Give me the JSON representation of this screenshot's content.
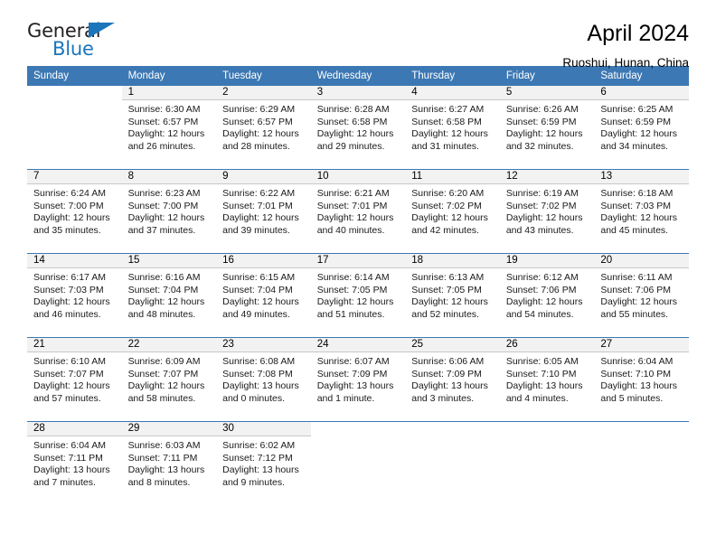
{
  "brand": {
    "name_top": "General",
    "name_bottom": "Blue",
    "triangle_color": "#1b75bb",
    "text_color": "#231f20"
  },
  "header": {
    "title": "April 2024",
    "subtitle": "Ruoshui, Hunan, China"
  },
  "theme": {
    "header_row_bg": "#3c78b4",
    "header_row_text": "#ffffff",
    "daynum_band_bg": "#f2f2f2",
    "cell_divider": "#c8c8c8"
  },
  "weekdays": [
    "Sunday",
    "Monday",
    "Tuesday",
    "Wednesday",
    "Thursday",
    "Friday",
    "Saturday"
  ],
  "weeks": [
    [
      {
        "day": "",
        "sunrise": "",
        "sunset": "",
        "daylight1": "",
        "daylight2": ""
      },
      {
        "day": "1",
        "sunrise": "Sunrise: 6:30 AM",
        "sunset": "Sunset: 6:57 PM",
        "daylight1": "Daylight: 12 hours",
        "daylight2": "and 26 minutes."
      },
      {
        "day": "2",
        "sunrise": "Sunrise: 6:29 AM",
        "sunset": "Sunset: 6:57 PM",
        "daylight1": "Daylight: 12 hours",
        "daylight2": "and 28 minutes."
      },
      {
        "day": "3",
        "sunrise": "Sunrise: 6:28 AM",
        "sunset": "Sunset: 6:58 PM",
        "daylight1": "Daylight: 12 hours",
        "daylight2": "and 29 minutes."
      },
      {
        "day": "4",
        "sunrise": "Sunrise: 6:27 AM",
        "sunset": "Sunset: 6:58 PM",
        "daylight1": "Daylight: 12 hours",
        "daylight2": "and 31 minutes."
      },
      {
        "day": "5",
        "sunrise": "Sunrise: 6:26 AM",
        "sunset": "Sunset: 6:59 PM",
        "daylight1": "Daylight: 12 hours",
        "daylight2": "and 32 minutes."
      },
      {
        "day": "6",
        "sunrise": "Sunrise: 6:25 AM",
        "sunset": "Sunset: 6:59 PM",
        "daylight1": "Daylight: 12 hours",
        "daylight2": "and 34 minutes."
      }
    ],
    [
      {
        "day": "7",
        "sunrise": "Sunrise: 6:24 AM",
        "sunset": "Sunset: 7:00 PM",
        "daylight1": "Daylight: 12 hours",
        "daylight2": "and 35 minutes."
      },
      {
        "day": "8",
        "sunrise": "Sunrise: 6:23 AM",
        "sunset": "Sunset: 7:00 PM",
        "daylight1": "Daylight: 12 hours",
        "daylight2": "and 37 minutes."
      },
      {
        "day": "9",
        "sunrise": "Sunrise: 6:22 AM",
        "sunset": "Sunset: 7:01 PM",
        "daylight1": "Daylight: 12 hours",
        "daylight2": "and 39 minutes."
      },
      {
        "day": "10",
        "sunrise": "Sunrise: 6:21 AM",
        "sunset": "Sunset: 7:01 PM",
        "daylight1": "Daylight: 12 hours",
        "daylight2": "and 40 minutes."
      },
      {
        "day": "11",
        "sunrise": "Sunrise: 6:20 AM",
        "sunset": "Sunset: 7:02 PM",
        "daylight1": "Daylight: 12 hours",
        "daylight2": "and 42 minutes."
      },
      {
        "day": "12",
        "sunrise": "Sunrise: 6:19 AM",
        "sunset": "Sunset: 7:02 PM",
        "daylight1": "Daylight: 12 hours",
        "daylight2": "and 43 minutes."
      },
      {
        "day": "13",
        "sunrise": "Sunrise: 6:18 AM",
        "sunset": "Sunset: 7:03 PM",
        "daylight1": "Daylight: 12 hours",
        "daylight2": "and 45 minutes."
      }
    ],
    [
      {
        "day": "14",
        "sunrise": "Sunrise: 6:17 AM",
        "sunset": "Sunset: 7:03 PM",
        "daylight1": "Daylight: 12 hours",
        "daylight2": "and 46 minutes."
      },
      {
        "day": "15",
        "sunrise": "Sunrise: 6:16 AM",
        "sunset": "Sunset: 7:04 PM",
        "daylight1": "Daylight: 12 hours",
        "daylight2": "and 48 minutes."
      },
      {
        "day": "16",
        "sunrise": "Sunrise: 6:15 AM",
        "sunset": "Sunset: 7:04 PM",
        "daylight1": "Daylight: 12 hours",
        "daylight2": "and 49 minutes."
      },
      {
        "day": "17",
        "sunrise": "Sunrise: 6:14 AM",
        "sunset": "Sunset: 7:05 PM",
        "daylight1": "Daylight: 12 hours",
        "daylight2": "and 51 minutes."
      },
      {
        "day": "18",
        "sunrise": "Sunrise: 6:13 AM",
        "sunset": "Sunset: 7:05 PM",
        "daylight1": "Daylight: 12 hours",
        "daylight2": "and 52 minutes."
      },
      {
        "day": "19",
        "sunrise": "Sunrise: 6:12 AM",
        "sunset": "Sunset: 7:06 PM",
        "daylight1": "Daylight: 12 hours",
        "daylight2": "and 54 minutes."
      },
      {
        "day": "20",
        "sunrise": "Sunrise: 6:11 AM",
        "sunset": "Sunset: 7:06 PM",
        "daylight1": "Daylight: 12 hours",
        "daylight2": "and 55 minutes."
      }
    ],
    [
      {
        "day": "21",
        "sunrise": "Sunrise: 6:10 AM",
        "sunset": "Sunset: 7:07 PM",
        "daylight1": "Daylight: 12 hours",
        "daylight2": "and 57 minutes."
      },
      {
        "day": "22",
        "sunrise": "Sunrise: 6:09 AM",
        "sunset": "Sunset: 7:07 PM",
        "daylight1": "Daylight: 12 hours",
        "daylight2": "and 58 minutes."
      },
      {
        "day": "23",
        "sunrise": "Sunrise: 6:08 AM",
        "sunset": "Sunset: 7:08 PM",
        "daylight1": "Daylight: 13 hours",
        "daylight2": "and 0 minutes."
      },
      {
        "day": "24",
        "sunrise": "Sunrise: 6:07 AM",
        "sunset": "Sunset: 7:09 PM",
        "daylight1": "Daylight: 13 hours",
        "daylight2": "and 1 minute."
      },
      {
        "day": "25",
        "sunrise": "Sunrise: 6:06 AM",
        "sunset": "Sunset: 7:09 PM",
        "daylight1": "Daylight: 13 hours",
        "daylight2": "and 3 minutes."
      },
      {
        "day": "26",
        "sunrise": "Sunrise: 6:05 AM",
        "sunset": "Sunset: 7:10 PM",
        "daylight1": "Daylight: 13 hours",
        "daylight2": "and 4 minutes."
      },
      {
        "day": "27",
        "sunrise": "Sunrise: 6:04 AM",
        "sunset": "Sunset: 7:10 PM",
        "daylight1": "Daylight: 13 hours",
        "daylight2": "and 5 minutes."
      }
    ],
    [
      {
        "day": "28",
        "sunrise": "Sunrise: 6:04 AM",
        "sunset": "Sunset: 7:11 PM",
        "daylight1": "Daylight: 13 hours",
        "daylight2": "and 7 minutes."
      },
      {
        "day": "29",
        "sunrise": "Sunrise: 6:03 AM",
        "sunset": "Sunset: 7:11 PM",
        "daylight1": "Daylight: 13 hours",
        "daylight2": "and 8 minutes."
      },
      {
        "day": "30",
        "sunrise": "Sunrise: 6:02 AM",
        "sunset": "Sunset: 7:12 PM",
        "daylight1": "Daylight: 13 hours",
        "daylight2": "and 9 minutes."
      },
      {
        "day": "",
        "sunrise": "",
        "sunset": "",
        "daylight1": "",
        "daylight2": ""
      },
      {
        "day": "",
        "sunrise": "",
        "sunset": "",
        "daylight1": "",
        "daylight2": ""
      },
      {
        "day": "",
        "sunrise": "",
        "sunset": "",
        "daylight1": "",
        "daylight2": ""
      },
      {
        "day": "",
        "sunrise": "",
        "sunset": "",
        "daylight1": "",
        "daylight2": ""
      }
    ]
  ]
}
